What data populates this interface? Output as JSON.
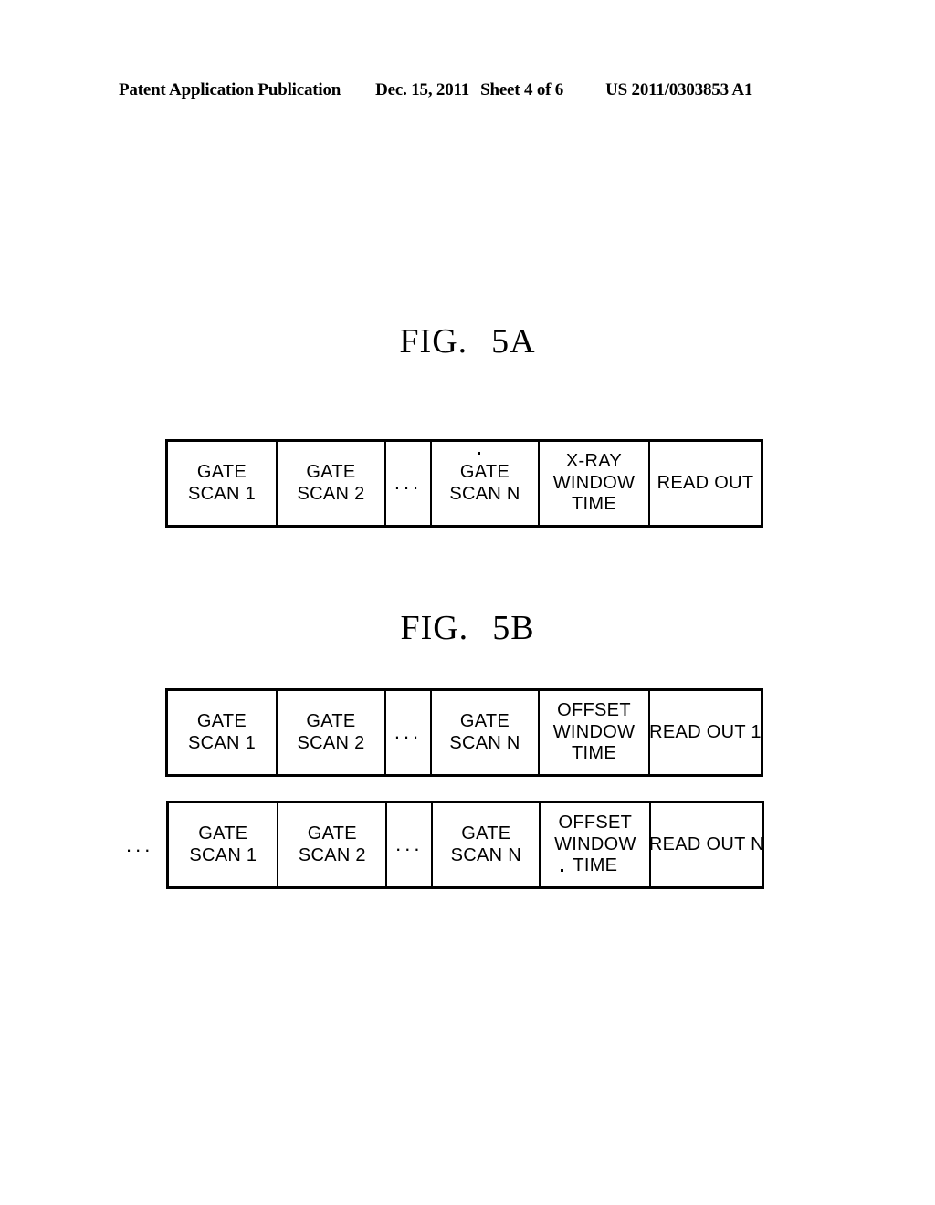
{
  "header": {
    "publication": "Patent Application Publication",
    "date": "Dec. 15, 2011",
    "sheet": "Sheet 4 of 6",
    "patent_number": "US 2011/0303853 A1"
  },
  "figures": [
    {
      "id": "fig5a",
      "title_word": "FIG.",
      "title_number": "5A",
      "rows": [
        {
          "lead_ellipsis": "",
          "cells": [
            {
              "type": "text",
              "lines": [
                "GATE",
                "SCAN 1"
              ]
            },
            {
              "type": "text",
              "lines": [
                "GATE",
                "SCAN 2"
              ]
            },
            {
              "type": "dots",
              "lines": [
                "..."
              ]
            },
            {
              "type": "text",
              "lines": [
                "GATE",
                "SCAN N"
              ]
            },
            {
              "type": "text",
              "lines": [
                "X-RAY",
                "WINDOW",
                "TIME"
              ]
            },
            {
              "type": "text",
              "lines": [
                "READ OUT"
              ]
            }
          ]
        }
      ]
    },
    {
      "id": "fig5b",
      "title_word": "FIG.",
      "title_number": "5B",
      "rows": [
        {
          "lead_ellipsis": "",
          "cells": [
            {
              "type": "text",
              "lines": [
                "GATE",
                "SCAN 1"
              ]
            },
            {
              "type": "text",
              "lines": [
                "GATE",
                "SCAN 2"
              ]
            },
            {
              "type": "dots",
              "lines": [
                "..."
              ]
            },
            {
              "type": "text",
              "lines": [
                "GATE",
                "SCAN N"
              ]
            },
            {
              "type": "text",
              "lines": [
                "OFFSET",
                "WINDOW",
                "TIME"
              ]
            },
            {
              "type": "text",
              "lines": [
                "READ OUT 1"
              ]
            }
          ]
        },
        {
          "lead_ellipsis": "...",
          "cells": [
            {
              "type": "text",
              "lines": [
                "GATE",
                "SCAN 1"
              ]
            },
            {
              "type": "text",
              "lines": [
                "GATE",
                "SCAN 2"
              ]
            },
            {
              "type": "dots",
              "lines": [
                "..."
              ]
            },
            {
              "type": "text",
              "lines": [
                "GATE",
                "SCAN N"
              ]
            },
            {
              "type": "text",
              "lines": [
                "OFFSET",
                "WINDOW",
                "TIME"
              ]
            },
            {
              "type": "text",
              "lines": [
                "READ OUT N"
              ]
            }
          ]
        }
      ]
    }
  ],
  "fig5a": {
    "title_word": "FIG.",
    "title_number": "5A",
    "row": {
      "c0": {
        "l0": "GATE",
        "l1": "SCAN 1"
      },
      "c1": {
        "l0": "GATE",
        "l1": "SCAN 2"
      },
      "c2": {
        "l0": "..."
      },
      "c3": {
        "l0": "GATE",
        "l1": "SCAN N"
      },
      "c4": {
        "l0": "X-RAY",
        "l1": "WINDOW",
        "l2": "TIME"
      },
      "c5": {
        "l0": "READ OUT"
      }
    }
  },
  "fig5b": {
    "title_word": "FIG.",
    "title_number": "5B",
    "row1": {
      "c0": {
        "l0": "GATE",
        "l1": "SCAN 1"
      },
      "c1": {
        "l0": "GATE",
        "l1": "SCAN 2"
      },
      "c2": {
        "l0": "..."
      },
      "c3": {
        "l0": "GATE",
        "l1": "SCAN N"
      },
      "c4": {
        "l0": "OFFSET",
        "l1": "WINDOW",
        "l2": "TIME"
      },
      "c5": {
        "l0": "READ OUT 1"
      }
    },
    "row2": {
      "lead_ellipsis": "...",
      "c0": {
        "l0": "GATE",
        "l1": "SCAN 1"
      },
      "c1": {
        "l0": "GATE",
        "l1": "SCAN 2"
      },
      "c2": {
        "l0": "..."
      },
      "c3": {
        "l0": "GATE",
        "l1": "SCAN N"
      },
      "c4": {
        "l0": "OFFSET",
        "l1": "WINDOW",
        "l2": "TIME"
      },
      "c5": {
        "l0": "READ OUT N"
      }
    }
  },
  "colors": {
    "ink": "#000000",
    "paper": "#ffffff"
  }
}
